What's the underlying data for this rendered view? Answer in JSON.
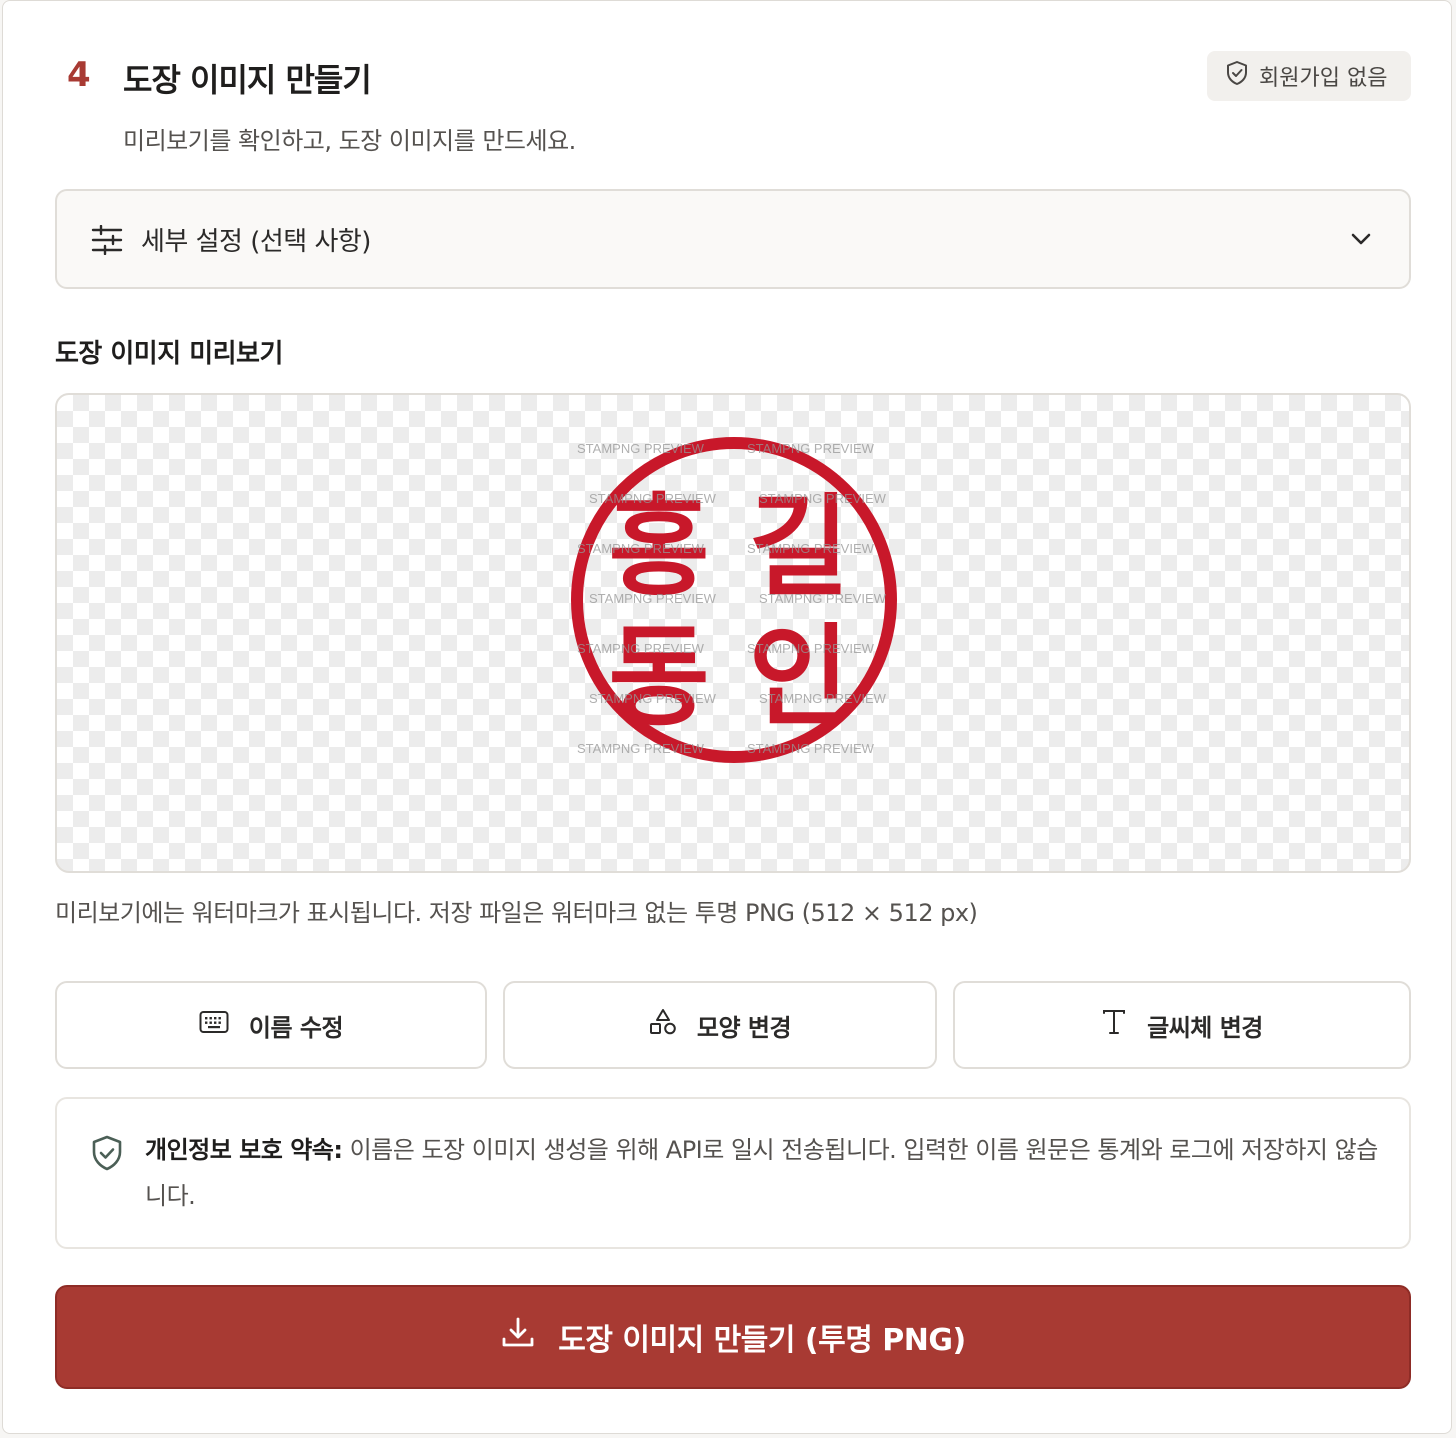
{
  "step": {
    "number": "4",
    "title": "도장 이미지 만들기",
    "subtitle": "미리보기를 확인하고, 도장 이미지를 만드세요."
  },
  "badge": {
    "label": "회원가입 없음",
    "icon": "shield-check-icon"
  },
  "settings": {
    "label": "세부 설정 (선택 사항)",
    "icon": "sliders-icon",
    "expanded": false
  },
  "preview": {
    "heading": "도장 이미지 미리보기",
    "stamp": {
      "line1": [
        "홍",
        "길"
      ],
      "line2": [
        "동",
        "인"
      ],
      "color": "#c8182a",
      "shape": "circle"
    },
    "watermark": "STAMPNG PREVIEW",
    "note": "미리보기에는 워터마크가 표시됩니다. 저장 파일은 워터마크 없는 투명 PNG (512 × 512 px)"
  },
  "actions": [
    {
      "label": "이름 수정",
      "icon": "keyboard-icon"
    },
    {
      "label": "모양 변경",
      "icon": "shapes-icon"
    },
    {
      "label": "글씨체 변경",
      "icon": "type-icon"
    }
  ],
  "privacy": {
    "title": "개인정보 보호 약속:",
    "body": "이름은 도장 이미지 생성을 위해 API로 일시 전송됩니다. 입력한 이름 원문은 통계와 로그에 저장하지 않습니다."
  },
  "cta": {
    "label": "도장 이미지 만들기 (투명 PNG)",
    "icon": "download-icon"
  },
  "colors": {
    "accent": "#a83a33",
    "stamp": "#c8182a"
  }
}
